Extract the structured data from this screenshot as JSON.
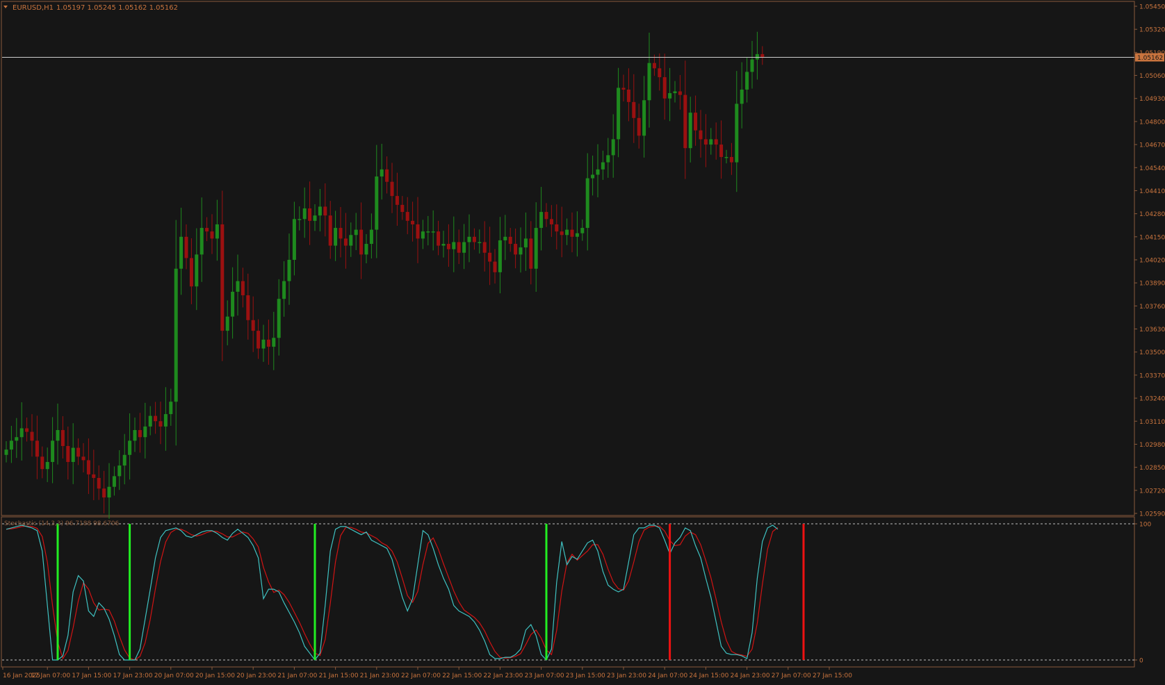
{
  "header": {
    "symbol_label": "EURUSD,H1",
    "ohlc": "1.05197 1.05245 1.05162 1.05162"
  },
  "indicator_label": "Stochastic (14,3,3) 96.7188 98.6706",
  "current_price_label": "1.05162",
  "colors": {
    "background": "#161616",
    "frame": "#8a5a3c",
    "text": "#c9743e",
    "bull": "#1e8a1e",
    "bear": "#9b1010",
    "stoch_main": "#3fc2c2",
    "stoch_signal": "#d11414",
    "buy_marker": "#22ee22",
    "sell_marker": "#ee1111",
    "price_line": "#cdcdcd"
  },
  "chart_data": [
    {
      "type": "candlestick",
      "symbol": "EURUSD",
      "timeframe": "H1",
      "ylim": [
        1.0259,
        1.0545
      ],
      "y_ticks": [
        "1.05450",
        "1.05320",
        "1.05190",
        "1.05060",
        "1.04930",
        "1.04800",
        "1.04670",
        "1.04540",
        "1.04410",
        "1.04280",
        "1.04150",
        "1.04020",
        "1.03890",
        "1.03760",
        "1.03630",
        "1.03500",
        "1.03370",
        "1.03240",
        "1.03110",
        "1.02980",
        "1.02850",
        "1.02720",
        "1.02590"
      ],
      "x_ticks": [
        "16 Jan 2025",
        "17 Jan 07:00",
        "17 Jan 15:00",
        "17 Jan 23:00",
        "20 Jan 07:00",
        "20 Jan 15:00",
        "20 Jan 23:00",
        "21 Jan 07:00",
        "21 Jan 15:00",
        "21 Jan 23:00",
        "22 Jan 07:00",
        "22 Jan 15:00",
        "22 Jan 23:00",
        "23 Jan 07:00",
        "23 Jan 15:00",
        "23 Jan 23:00",
        "24 Jan 07:00",
        "24 Jan 15:00",
        "24 Jan 23:00",
        "27 Jan 07:00",
        "27 Jan 15:00"
      ],
      "current_price": 1.05162,
      "closes": [
        1.0295,
        1.03,
        1.0302,
        1.0307,
        1.0305,
        1.03,
        1.0291,
        1.0284,
        1.0288,
        1.03,
        1.0306,
        1.0297,
        1.0288,
        1.0296,
        1.0291,
        1.0289,
        1.0281,
        1.0279,
        1.0273,
        1.0268,
        1.0274,
        1.028,
        1.0286,
        1.0292,
        1.03,
        1.0306,
        1.0302,
        1.0308,
        1.0314,
        1.0311,
        1.0308,
        1.0315,
        1.0322,
        1.0397,
        1.0415,
        1.0403,
        1.0387,
        1.0405,
        1.042,
        1.0418,
        1.0414,
        1.0422,
        1.0362,
        1.037,
        1.0384,
        1.039,
        1.0382,
        1.0368,
        1.0362,
        1.0352,
        1.0357,
        1.0353,
        1.0358,
        1.038,
        1.039,
        1.0402,
        1.0425,
        1.0425,
        1.0431,
        1.0424,
        1.0427,
        1.0432,
        1.0427,
        1.041,
        1.042,
        1.0414,
        1.041,
        1.0416,
        1.0419,
        1.0405,
        1.0411,
        1.0419,
        1.0449,
        1.0453,
        1.0446,
        1.0438,
        1.0433,
        1.0429,
        1.0424,
        1.0422,
        1.0414,
        1.0418,
        1.0418,
        1.0418,
        1.041,
        1.0411,
        1.0408,
        1.0412,
        1.0406,
        1.0412,
        1.0415,
        1.0412,
        1.0412,
        1.0406,
        1.0401,
        1.0395,
        1.0413,
        1.0415,
        1.0411,
        1.0405,
        1.0409,
        1.0414,
        1.0397,
        1.042,
        1.0429,
        1.0425,
        1.0422,
        1.0418,
        1.0416,
        1.0419,
        1.0415,
        1.0417,
        1.042,
        1.0448,
        1.045,
        1.0453,
        1.0457,
        1.0461,
        1.047,
        1.0499,
        1.0498,
        1.0491,
        1.0482,
        1.0472,
        1.0492,
        1.0513,
        1.051,
        1.0505,
        1.0493,
        1.0496,
        1.0497,
        1.0495,
        1.0465,
        1.0485,
        1.0475,
        1.047,
        1.0467,
        1.047,
        1.0467,
        1.046,
        1.046,
        1.0457,
        1.049,
        1.0498,
        1.0508,
        1.0515,
        1.0518,
        1.0516
      ],
      "stochastic": {
        "params": "14,3,3",
        "main": 96.7188,
        "signal": 98.6706,
        "ylim": [
          0,
          100
        ],
        "levels": [
          0,
          100
        ],
        "main_line": [
          96,
          97,
          98,
          99,
          98,
          97,
          95,
          80,
          40,
          0,
          0,
          3,
          18,
          50,
          62,
          58,
          36,
          32,
          42,
          38,
          30,
          18,
          4,
          0,
          0,
          0,
          8,
          30,
          52,
          75,
          90,
          95,
          96,
          97,
          95,
          91,
          90,
          92,
          94,
          95,
          95,
          93,
          90,
          88,
          93,
          96,
          93,
          90,
          84,
          75,
          45,
          52,
          52,
          50,
          42,
          35,
          28,
          20,
          10,
          5,
          0,
          5,
          40,
          80,
          96,
          98,
          98,
          96,
          94,
          92,
          94,
          88,
          86,
          84,
          82,
          74,
          60,
          46,
          36,
          45,
          70,
          95,
          92,
          82,
          70,
          60,
          52,
          40,
          36,
          34,
          32,
          28,
          22,
          14,
          4,
          1,
          1,
          2,
          2,
          4,
          8,
          22,
          26,
          18,
          4,
          0,
          8,
          57,
          87,
          70,
          76,
          74,
          80,
          86,
          88,
          80,
          65,
          55,
          52,
          50,
          52,
          72,
          92,
          97,
          97,
          99,
          99,
          97,
          88,
          78,
          86,
          90,
          97,
          95,
          84,
          75,
          60,
          46,
          28,
          10,
          5,
          4,
          4,
          3,
          1,
          20,
          60,
          87,
          97,
          99,
          96
        ]
      },
      "markers": [
        {
          "bar": 10,
          "type": "buy"
        },
        {
          "bar": 24,
          "type": "buy"
        },
        {
          "bar": 60,
          "type": "buy"
        },
        {
          "bar": 105,
          "type": "buy"
        },
        {
          "bar": 129,
          "type": "sell"
        },
        {
          "bar": 155,
          "type": "sell"
        }
      ]
    }
  ]
}
